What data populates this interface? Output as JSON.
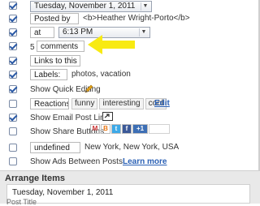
{
  "date_value": "Tuesday, November 1, 2011",
  "posted_by_label": "Posted by",
  "author_value": "<b>Heather Wright-Porto</b>",
  "at_label": "at",
  "time_value": "6:13 PM",
  "comments_count": "5",
  "comments_label": "comments",
  "links_label": "Links to this post",
  "labels_label": "Labels:",
  "labels_value": "photos, vacation",
  "quick_editing_label": "Show Quick Editing",
  "reactions_label": "Reactions:",
  "reactions": [
    "funny",
    "interesting",
    "cool"
  ],
  "edit_link": "Edit",
  "email_label": "Show Email Post Links",
  "share_label": "Show Share Buttons",
  "share_icons": [
    "M",
    "B",
    "t",
    "f",
    "+1"
  ],
  "location_value": "undefined",
  "location_text": "New York, New York, USA",
  "ads_label": "Show Ads Between Posts",
  "learn_more": "Learn more",
  "arrange_title": "Arrange Items",
  "arrange_date": "Tuesday, November 1, 2011",
  "arrange_post_title": "Post Title"
}
